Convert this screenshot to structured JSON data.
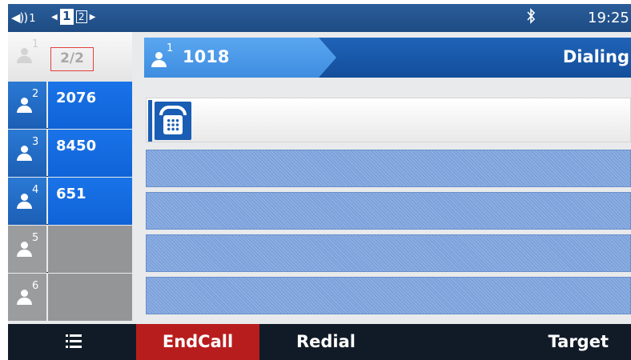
{
  "status_bar": {
    "volume_icon": "speaker-icon",
    "account_number": "1",
    "pages": [
      {
        "label": "1",
        "active": true
      },
      {
        "label": "2",
        "active": false
      }
    ],
    "bluetooth_icon": "bluetooth-icon",
    "time": "19:25"
  },
  "lines_panel": {
    "page_counter": "2/2",
    "lines": [
      {
        "index": "1",
        "label": ""
      },
      {
        "index": "2",
        "label": "2076",
        "state": "active"
      },
      {
        "index": "3",
        "label": "8450",
        "state": "active"
      },
      {
        "index": "4",
        "label": "651",
        "state": "active"
      },
      {
        "index": "5",
        "label": "",
        "state": "idle"
      },
      {
        "index": "6",
        "label": "",
        "state": "idle"
      }
    ]
  },
  "call": {
    "line_index": "1",
    "number": "1018",
    "status": "Dialing",
    "icon": "phone-icon"
  },
  "softkeys": {
    "menu_icon": "menu-icon",
    "end_call": "EndCall",
    "redial": "Redial",
    "target": "Target"
  },
  "colors": {
    "status_bar": "#1e4b82",
    "line_active": "#1a73e8",
    "line_idle": "#939597",
    "end_call": "#b81d1e",
    "softkey_bar": "#111b28"
  }
}
